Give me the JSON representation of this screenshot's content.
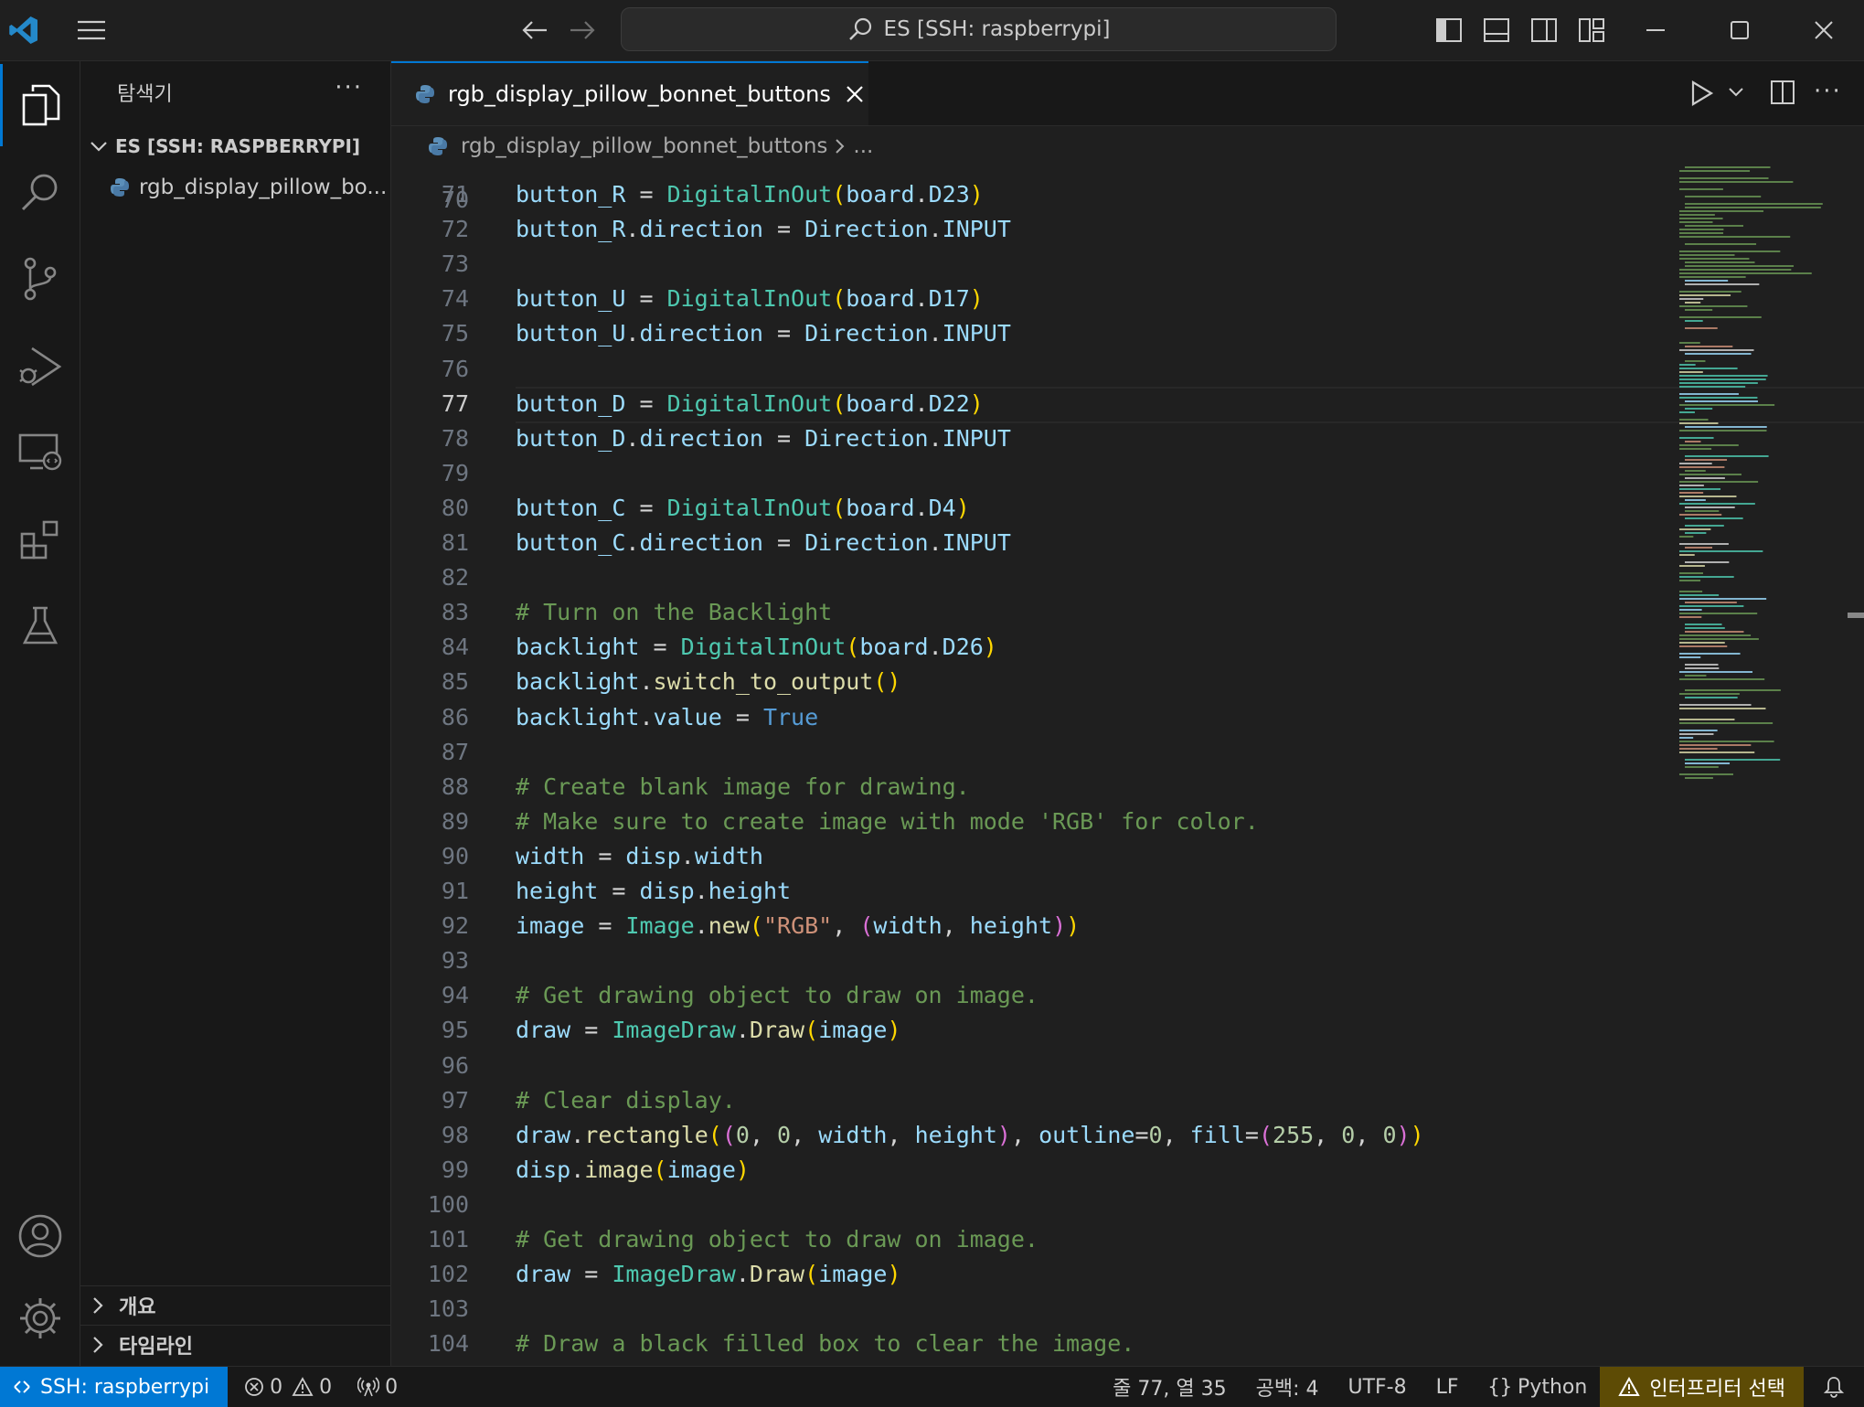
{
  "titlebar": {
    "search_text": "ES [SSH: raspberrypi]",
    "icons": [
      "vscode-logo-icon",
      "menu-icon",
      "back-arrow-icon",
      "forward-arrow-icon",
      "search-icon",
      "toggle-primary-sidebar-icon",
      "toggle-panel-icon",
      "toggle-secondary-sidebar-icon",
      "customize-layout-icon",
      "minimize-icon",
      "maximize-icon",
      "close-icon"
    ]
  },
  "activity_bar": {
    "items": [
      "explorer-icon",
      "search-icon",
      "source-control-icon",
      "run-debug-icon",
      "remote-explorer-icon",
      "extensions-icon",
      "testing-icon"
    ],
    "bottom": [
      "accounts-icon",
      "manage-gear-icon"
    ]
  },
  "sidebar": {
    "title": "탐색기",
    "more": "···",
    "folder": "ES [SSH: RASPBERRYPI]",
    "file": "rgb_display_pillow_bo...",
    "outline": "개요",
    "timeline": "타임라인"
  },
  "editor": {
    "tab_label": "rgb_display_pillow_bonnet_buttons",
    "breadcrumb_file": "rgb_display_pillow_bonnet_buttons",
    "breadcrumb_more": "...",
    "partial_top_line": "70",
    "lines": [
      {
        "n": "71",
        "parts": [
          [
            "kv",
            "button_R"
          ],
          [
            "op",
            " = "
          ],
          [
            "cl",
            "DigitalInOut"
          ],
          [
            "b1",
            "("
          ],
          [
            "kv",
            "board"
          ],
          [
            "op",
            "."
          ],
          [
            "kv",
            "D23"
          ],
          [
            "b1",
            ")"
          ]
        ]
      },
      {
        "n": "72",
        "parts": [
          [
            "kv",
            "button_R"
          ],
          [
            "op",
            "."
          ],
          [
            "kv",
            "direction"
          ],
          [
            "op",
            " = "
          ],
          [
            "kv",
            "Direction"
          ],
          [
            "op",
            "."
          ],
          [
            "kv",
            "INPUT"
          ]
        ]
      },
      {
        "n": "73",
        "parts": []
      },
      {
        "n": "74",
        "parts": [
          [
            "kv",
            "button_U"
          ],
          [
            "op",
            " = "
          ],
          [
            "cl",
            "DigitalInOut"
          ],
          [
            "b1",
            "("
          ],
          [
            "kv",
            "board"
          ],
          [
            "op",
            "."
          ],
          [
            "kv",
            "D17"
          ],
          [
            "b1",
            ")"
          ]
        ]
      },
      {
        "n": "75",
        "parts": [
          [
            "kv",
            "button_U"
          ],
          [
            "op",
            "."
          ],
          [
            "kv",
            "direction"
          ],
          [
            "op",
            " = "
          ],
          [
            "kv",
            "Direction"
          ],
          [
            "op",
            "."
          ],
          [
            "kv",
            "INPUT"
          ]
        ]
      },
      {
        "n": "76",
        "parts": []
      },
      {
        "n": "77",
        "current": true,
        "parts": [
          [
            "kv",
            "button_D"
          ],
          [
            "op",
            " = "
          ],
          [
            "cl",
            "DigitalInOut"
          ],
          [
            "b1",
            "("
          ],
          [
            "kv",
            "board"
          ],
          [
            "op",
            "."
          ],
          [
            "kv",
            "D22"
          ],
          [
            "b1",
            ")"
          ]
        ]
      },
      {
        "n": "78",
        "parts": [
          [
            "kv",
            "button_D"
          ],
          [
            "op",
            "."
          ],
          [
            "kv",
            "direction"
          ],
          [
            "op",
            " = "
          ],
          [
            "kv",
            "Direction"
          ],
          [
            "op",
            "."
          ],
          [
            "kv",
            "INPUT"
          ]
        ]
      },
      {
        "n": "79",
        "parts": []
      },
      {
        "n": "80",
        "parts": [
          [
            "kv",
            "button_C"
          ],
          [
            "op",
            " = "
          ],
          [
            "cl",
            "DigitalInOut"
          ],
          [
            "b1",
            "("
          ],
          [
            "kv",
            "board"
          ],
          [
            "op",
            "."
          ],
          [
            "kv",
            "D4"
          ],
          [
            "b1",
            ")"
          ]
        ]
      },
      {
        "n": "81",
        "parts": [
          [
            "kv",
            "button_C"
          ],
          [
            "op",
            "."
          ],
          [
            "kv",
            "direction"
          ],
          [
            "op",
            " = "
          ],
          [
            "kv",
            "Direction"
          ],
          [
            "op",
            "."
          ],
          [
            "kv",
            "INPUT"
          ]
        ]
      },
      {
        "n": "82",
        "parts": []
      },
      {
        "n": "83",
        "parts": [
          [
            "cm",
            "# Turn on the Backlight"
          ]
        ]
      },
      {
        "n": "84",
        "parts": [
          [
            "kv",
            "backlight"
          ],
          [
            "op",
            " = "
          ],
          [
            "cl",
            "DigitalInOut"
          ],
          [
            "b1",
            "("
          ],
          [
            "kv",
            "board"
          ],
          [
            "op",
            "."
          ],
          [
            "kv",
            "D26"
          ],
          [
            "b1",
            ")"
          ]
        ]
      },
      {
        "n": "85",
        "parts": [
          [
            "kv",
            "backlight"
          ],
          [
            "op",
            "."
          ],
          [
            "fn",
            "switch_to_output"
          ],
          [
            "b1",
            "()"
          ]
        ]
      },
      {
        "n": "86",
        "parts": [
          [
            "kv",
            "backlight"
          ],
          [
            "op",
            "."
          ],
          [
            "kv",
            "value"
          ],
          [
            "op",
            " = "
          ],
          [
            "kw",
            "True"
          ]
        ]
      },
      {
        "n": "87",
        "parts": []
      },
      {
        "n": "88",
        "parts": [
          [
            "cm",
            "# Create blank image for drawing."
          ]
        ]
      },
      {
        "n": "89",
        "parts": [
          [
            "cm",
            "# Make sure to create image with mode 'RGB' for color."
          ]
        ]
      },
      {
        "n": "90",
        "parts": [
          [
            "kv",
            "width"
          ],
          [
            "op",
            " = "
          ],
          [
            "kv",
            "disp"
          ],
          [
            "op",
            "."
          ],
          [
            "kv",
            "width"
          ]
        ]
      },
      {
        "n": "91",
        "parts": [
          [
            "kv",
            "height"
          ],
          [
            "op",
            " = "
          ],
          [
            "kv",
            "disp"
          ],
          [
            "op",
            "."
          ],
          [
            "kv",
            "height"
          ]
        ]
      },
      {
        "n": "92",
        "parts": [
          [
            "kv",
            "image"
          ],
          [
            "op",
            " = "
          ],
          [
            "cl",
            "Image"
          ],
          [
            "op",
            "."
          ],
          [
            "fn",
            "new"
          ],
          [
            "b1",
            "("
          ],
          [
            "st",
            "\"RGB\""
          ],
          [
            "op",
            ", "
          ],
          [
            "b2",
            "("
          ],
          [
            "kv",
            "width"
          ],
          [
            "op",
            ", "
          ],
          [
            "kv",
            "height"
          ],
          [
            "b2",
            ")"
          ],
          [
            "b1",
            ")"
          ]
        ]
      },
      {
        "n": "93",
        "parts": []
      },
      {
        "n": "94",
        "parts": [
          [
            "cm",
            "# Get drawing object to draw on image."
          ]
        ]
      },
      {
        "n": "95",
        "parts": [
          [
            "kv",
            "draw"
          ],
          [
            "op",
            " = "
          ],
          [
            "cl",
            "ImageDraw"
          ],
          [
            "op",
            "."
          ],
          [
            "fn",
            "Draw"
          ],
          [
            "b1",
            "("
          ],
          [
            "kv",
            "image"
          ],
          [
            "b1",
            ")"
          ]
        ]
      },
      {
        "n": "96",
        "parts": []
      },
      {
        "n": "97",
        "parts": [
          [
            "cm",
            "# Clear display."
          ]
        ]
      },
      {
        "n": "98",
        "parts": [
          [
            "kv",
            "draw"
          ],
          [
            "op",
            "."
          ],
          [
            "fn",
            "rectangle"
          ],
          [
            "b1",
            "("
          ],
          [
            "b2",
            "("
          ],
          [
            "nm",
            "0"
          ],
          [
            "op",
            ", "
          ],
          [
            "nm",
            "0"
          ],
          [
            "op",
            ", "
          ],
          [
            "kv",
            "width"
          ],
          [
            "op",
            ", "
          ],
          [
            "kv",
            "height"
          ],
          [
            "b2",
            ")"
          ],
          [
            "op",
            ", "
          ],
          [
            "kv",
            "outline"
          ],
          [
            "op",
            "="
          ],
          [
            "nm",
            "0"
          ],
          [
            "op",
            ", "
          ],
          [
            "kv",
            "fill"
          ],
          [
            "op",
            "="
          ],
          [
            "b2",
            "("
          ],
          [
            "nm",
            "255"
          ],
          [
            "op",
            ", "
          ],
          [
            "nm",
            "0"
          ],
          [
            "op",
            ", "
          ],
          [
            "nm",
            "0"
          ],
          [
            "b2",
            ")"
          ],
          [
            "b1",
            ")"
          ]
        ]
      },
      {
        "n": "99",
        "parts": [
          [
            "kv",
            "disp"
          ],
          [
            "op",
            "."
          ],
          [
            "fn",
            "image"
          ],
          [
            "b1",
            "("
          ],
          [
            "kv",
            "image"
          ],
          [
            "b1",
            ")"
          ]
        ]
      },
      {
        "n": "100",
        "parts": []
      },
      {
        "n": "101",
        "parts": [
          [
            "cm",
            "# Get drawing object to draw on image."
          ]
        ]
      },
      {
        "n": "102",
        "parts": [
          [
            "kv",
            "draw"
          ],
          [
            "op",
            " = "
          ],
          [
            "cl",
            "ImageDraw"
          ],
          [
            "op",
            "."
          ],
          [
            "fn",
            "Draw"
          ],
          [
            "b1",
            "("
          ],
          [
            "kv",
            "image"
          ],
          [
            "b1",
            ")"
          ]
        ]
      },
      {
        "n": "103",
        "parts": []
      },
      {
        "n": "104",
        "parts": [
          [
            "cm",
            "# Draw a black filled box to clear the image."
          ]
        ]
      }
    ]
  },
  "statusbar": {
    "remote": "SSH: raspberrypi",
    "errors": "0",
    "warnings": "0",
    "ports": "0",
    "cursor": "줄 77, 열 35",
    "spaces": "공백: 4",
    "encoding": "UTF-8",
    "eol": "LF",
    "language": "Python",
    "interpreter": "인터프리터 선택"
  },
  "colors": {
    "accent": "#0078d4",
    "interpreter_bg": "#5d4b05",
    "background": "#1f1f1f"
  }
}
